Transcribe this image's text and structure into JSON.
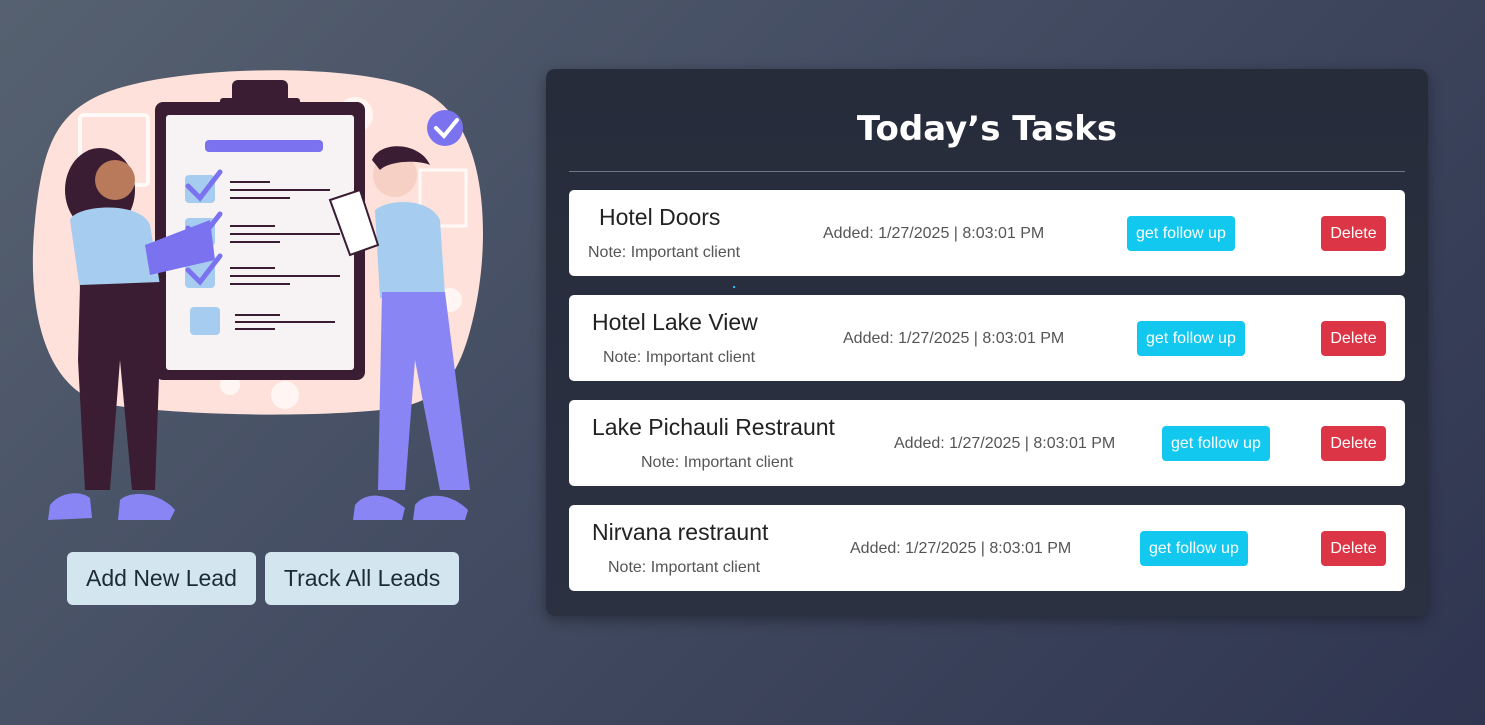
{
  "actions": {
    "add_lead": "Add New Lead",
    "track_leads": "Track All Leads"
  },
  "panel": {
    "title": "Today’s Tasks"
  },
  "tasks": [
    {
      "name": "Hotel Doors",
      "note": "Note: Important client",
      "added": "Added: 1/27/2025 | 8:03:01 PM",
      "follow_label": "get follow up",
      "delete_label": "Delete"
    },
    {
      "name": "Hotel Lake View",
      "note": "Note: Important client",
      "added": "Added: 1/27/2025 | 8:03:01 PM",
      "follow_label": "get follow up",
      "delete_label": "Delete"
    },
    {
      "name": "Lake Pichauli Restraunt",
      "note": "Note: Important client",
      "added": "Added: 1/27/2025 | 8:03:01 PM",
      "follow_label": "get follow up",
      "delete_label": "Delete"
    },
    {
      "name": "Nirvana restraunt",
      "note": "Note: Important client",
      "added": "Added: 1/27/2025 | 8:03:01 PM",
      "follow_label": "get follow up",
      "delete_label": "Delete"
    }
  ],
  "colors": {
    "follow_button": "#12c8ef",
    "delete_button": "#dc3545",
    "lead_button": "#d3e5ef",
    "panel_bg": "#272d3b"
  },
  "icons": {
    "illustration": "task-checklist-illustration",
    "check": "checkmark-icon"
  }
}
